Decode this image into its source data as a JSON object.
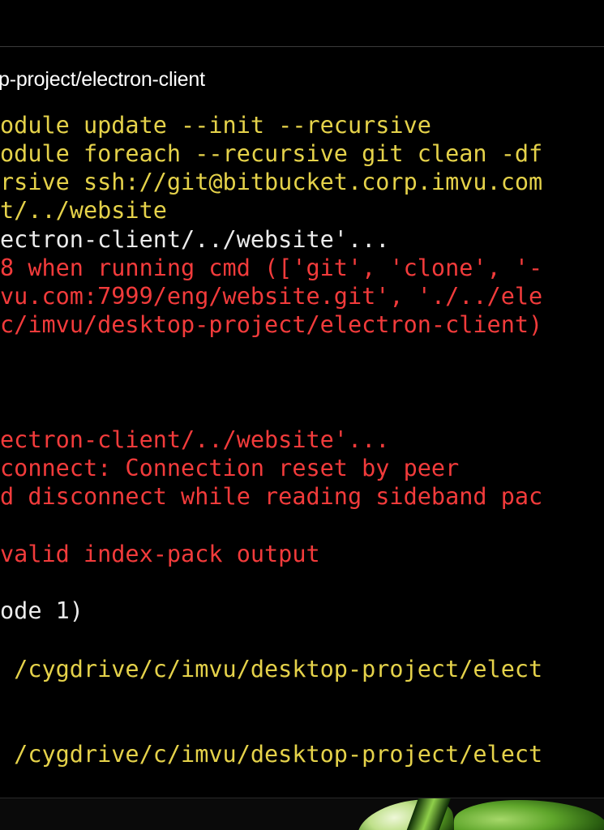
{
  "window": {
    "title": "p-project/electron-client"
  },
  "colors": {
    "yellow": "#e5d24a",
    "red": "#f23b3b",
    "white": "#ececec",
    "background": "#000000"
  },
  "terminal": {
    "lines": [
      {
        "text": "odule update --init --recursive",
        "color": "yellow"
      },
      {
        "text": "odule foreach --recursive git clean -df",
        "color": "yellow"
      },
      {
        "text": "rsive ssh://git@bitbucket.corp.imvu.com",
        "color": "yellow"
      },
      {
        "text": "t/../website",
        "color": "yellow"
      },
      {
        "text": "ectron-client/../website'...",
        "color": "white"
      },
      {
        "text": "8 when running cmd (['git', 'clone', '-",
        "color": "red"
      },
      {
        "text": "vu.com:7999/eng/website.git', './../ele",
        "color": "red"
      },
      {
        "text": "c/imvu/desktop-project/electron-client)",
        "color": "red"
      },
      {
        "text": "",
        "color": "white"
      },
      {
        "text": "",
        "color": "white"
      },
      {
        "text": "",
        "color": "white"
      },
      {
        "text": "ectron-client/../website'...",
        "color": "red"
      },
      {
        "text": "connect: Connection reset by peer",
        "color": "red"
      },
      {
        "text": "d disconnect while reading sideband pac",
        "color": "red"
      },
      {
        "text": "",
        "color": "white"
      },
      {
        "text": "valid index-pack output",
        "color": "red"
      },
      {
        "text": "",
        "color": "white"
      },
      {
        "text": "ode 1)",
        "color": "white"
      },
      {
        "text": "",
        "color": "white"
      },
      {
        "text": " /cygdrive/c/imvu/desktop-project/elect",
        "color": "yellow"
      },
      {
        "text": "",
        "color": "white"
      },
      {
        "text": "",
        "color": "white"
      },
      {
        "text": " /cygdrive/c/imvu/desktop-project/elect",
        "color": "yellow"
      }
    ]
  },
  "wallpaper": {
    "icon": "green-leaves-wallpaper"
  }
}
